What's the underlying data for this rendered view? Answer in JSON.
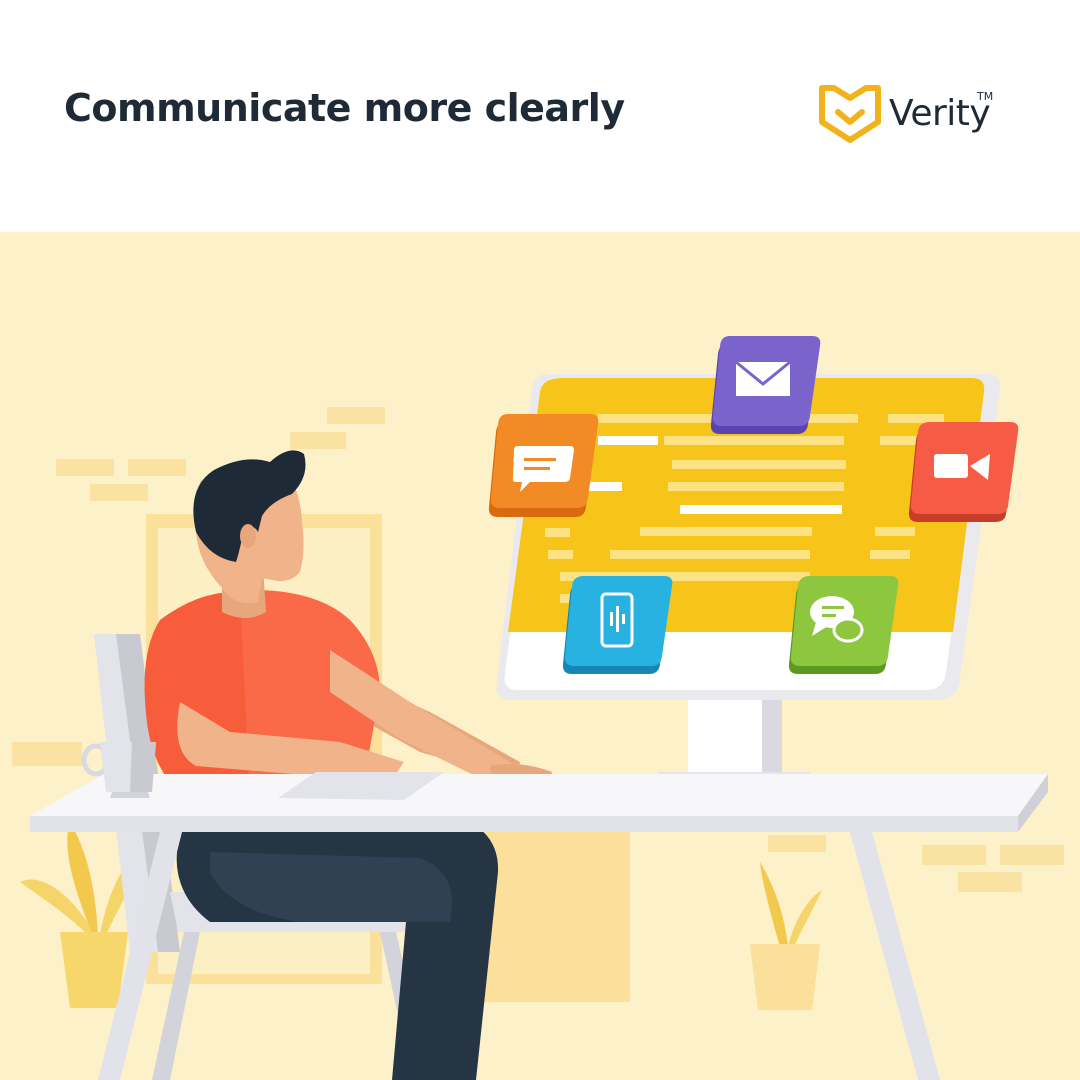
{
  "headline": "Communicate more clearly",
  "brand": {
    "name": "Verity",
    "trademark": "TM",
    "mark_color": "#f2b31a"
  },
  "illustration": {
    "background_color": "#fcf1c9",
    "screen_color": "#f7c519",
    "app_icons": [
      {
        "icon": "message-icon",
        "color": "#f28b25"
      },
      {
        "icon": "email-icon",
        "color": "#7b63cc"
      },
      {
        "icon": "video-icon",
        "color": "#f65c45"
      },
      {
        "icon": "phone-audio-icon",
        "color": "#27b2e2"
      },
      {
        "icon": "chat-bubbles-icon",
        "color": "#8dc63f"
      }
    ]
  }
}
